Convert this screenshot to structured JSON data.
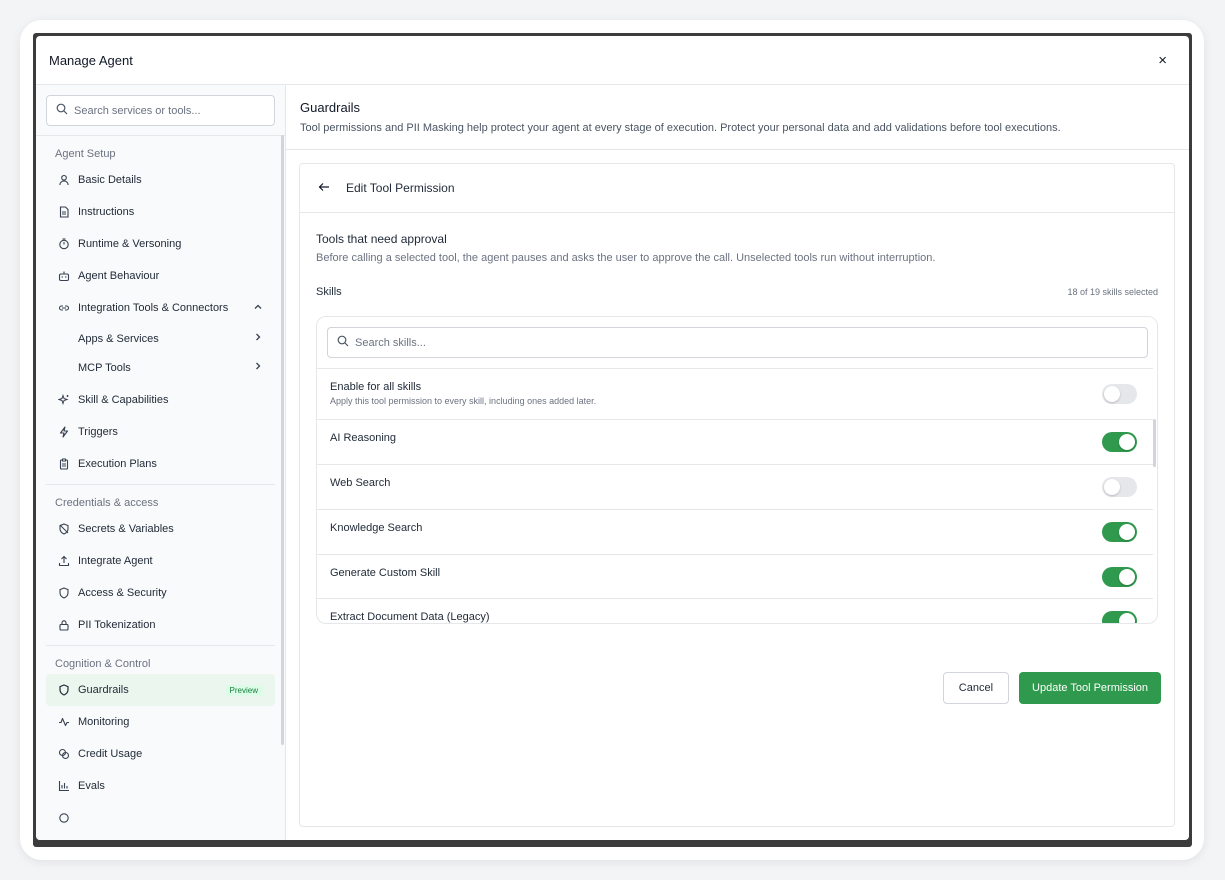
{
  "modal": {
    "title": "Manage Agent",
    "close_label": "×"
  },
  "sidebar": {
    "search_placeholder": "Search services or tools...",
    "sections": {
      "agent_setup": "Agent Setup",
      "credentials": "Credentials & access",
      "cognition": "Cognition & Control"
    },
    "items": {
      "basic_details": "Basic Details",
      "instructions": "Instructions",
      "runtime": "Runtime & Versoning",
      "agent_behaviour": "Agent Behaviour",
      "integration": "Integration Tools & Connectors",
      "apps_services": "Apps & Services",
      "mcp_tools": "MCP Tools",
      "skill_capabilities": "Skill & Capabilities",
      "triggers": "Triggers",
      "execution_plans": "Execution Plans",
      "secrets": "Secrets & Variables",
      "integrate_agent": "Integrate Agent",
      "access_security": "Access & Security",
      "pii_tokenization": "PII Tokenization",
      "guardrails": "Guardrails",
      "guardrails_badge": "Preview",
      "monitoring": "Monitoring",
      "credit_usage": "Credit Usage",
      "evals": "Evals"
    }
  },
  "main": {
    "title": "Guardrails",
    "description": "Tool permissions and PII Masking help protect your agent at every stage of execution. Protect your personal data and add validations before tool executions.",
    "panel": {
      "title": "Edit Tool Permission",
      "approval_title": "Tools that need approval",
      "approval_desc": "Before calling a selected tool, the agent pauses and asks the user to approve the call. Unselected tools run without interruption.",
      "skills_label": "Skills",
      "skills_count": "18 of 19 skills selected",
      "skills_search_placeholder": "Search skills...",
      "enable_all": {
        "label": "Enable for all skills",
        "sub": "Apply this tool permission to every skill, including ones added later.",
        "enabled": false
      },
      "skills": [
        {
          "name": "AI Reasoning",
          "enabled": true
        },
        {
          "name": "Web Search",
          "enabled": false
        },
        {
          "name": "Knowledge Search",
          "enabled": true
        },
        {
          "name": "Generate Custom Skill",
          "enabled": true
        },
        {
          "name": "Extract Document Data (Legacy)",
          "enabled": true
        }
      ],
      "cancel_label": "Cancel",
      "submit_label": "Update Tool Permission"
    }
  },
  "colors": {
    "accent": "#2f9a4d",
    "toggle_off": "#e5e7eb",
    "active_bg": "#ebf7ee"
  }
}
